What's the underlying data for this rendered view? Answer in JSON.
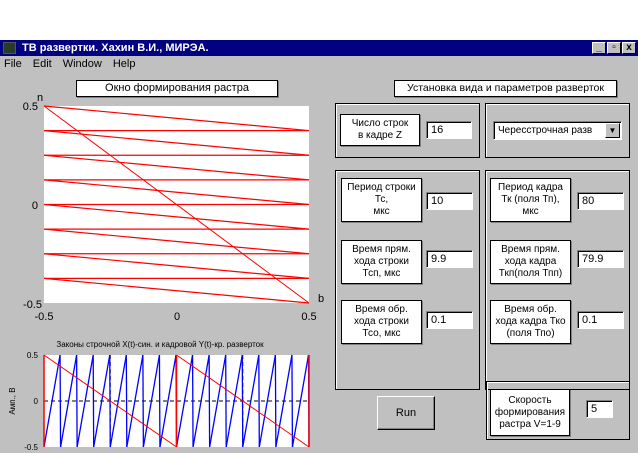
{
  "window": {
    "title": "ТВ развертки. Хахин В.И., МИРЭА.",
    "minimize": "_",
    "restore": "▫",
    "close": "x"
  },
  "menu": [
    "File",
    "Edit",
    "Window",
    "Help"
  ],
  "raster_button": "Окно формирования растра",
  "settings_button": "Установка вида и параметров разверток",
  "lines_per_frame": {
    "label1": "Число строк",
    "label2": "в кадре  Z",
    "value": "16"
  },
  "scan_type": {
    "selected": "Чересстрочная разв"
  },
  "line_params": {
    "period": {
      "l1": "Период строки",
      "l2": "Тс,",
      "l3": "мкс",
      "value": "10"
    },
    "forward": {
      "l1": "Время прям.",
      "l2": "хода строки",
      "l3": "Тсп, мкс",
      "value": "9.9"
    },
    "reverse": {
      "l1": "Время обр.",
      "l2": "хода строки",
      "l3": "Тсо, мкс",
      "value": "0.1"
    }
  },
  "frame_params": {
    "period": {
      "l1": "Период кадра",
      "l2": "Тк (поля Тп),",
      "l3": "мкс",
      "value": "80"
    },
    "forward": {
      "l1": "Время прям.",
      "l2": "хода кадра",
      "l3": "Ткп(поля Тпп)",
      "value": "79.9"
    },
    "reverse": {
      "l1": "Время обр.",
      "l2": "хода кадра Тко",
      "l3": "(поля Тпо)",
      "value": "0.1"
    }
  },
  "run_button": "Run",
  "speed": {
    "l1": "Скорость",
    "l2": "формирования",
    "l3": "растра V=1-9",
    "value": "5"
  },
  "chart_data": [
    {
      "type": "line",
      "title": "",
      "xlabel": "b",
      "ylabel": "h",
      "xlim": [
        -0.5,
        0.5
      ],
      "ylim": [
        -0.5,
        0.5
      ],
      "xticks": [
        "-0.5",
        "0",
        "0.5"
      ],
      "yticks": [
        "-0.5",
        "0",
        "0.5"
      ],
      "lines_per_field": 8,
      "color": "#ff0000"
    },
    {
      "type": "line",
      "title": "Законы строчной X(t)-син. и кадровой  Y(t)-кр. разверток",
      "ylabel": "Амп., В",
      "ylim": [
        -0.5,
        0.5
      ],
      "yticks": [
        "0.5",
        "0",
        "-0.5"
      ],
      "series": [
        {
          "name": "X(t)",
          "color": "#0000ff",
          "periods": 16,
          "amplitude": [
            -0.5,
            0.5
          ]
        },
        {
          "name": "Y(t)",
          "color": "#ff0000",
          "periods": 2,
          "amplitude": [
            0.5,
            -0.5
          ]
        }
      ]
    }
  ]
}
